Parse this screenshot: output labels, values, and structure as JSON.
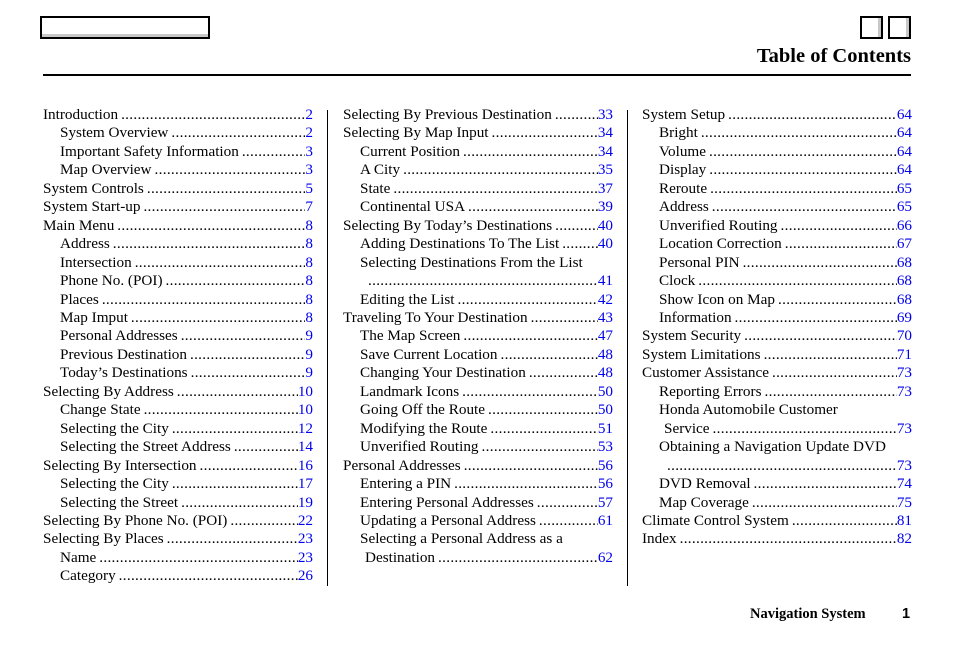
{
  "header": {
    "title": "Table of Contents"
  },
  "footer": {
    "section": "Navigation System",
    "page_number": "1"
  },
  "colors": {
    "link": "#0000ee",
    "text": "#000000"
  },
  "columns": [
    {
      "entries": [
        {
          "label": "Introduction",
          "page": "2",
          "level": 1
        },
        {
          "label": "System Overview",
          "page": "2",
          "level": 2
        },
        {
          "label": "Important Safety Information",
          "page": "3",
          "level": 2
        },
        {
          "label": "Map Overview",
          "page": "3",
          "level": 2
        },
        {
          "label": "System Controls",
          "page": "5",
          "level": 1
        },
        {
          "label": "System Start-up",
          "page": "7",
          "level": 1
        },
        {
          "label": "Main Menu",
          "page": "8",
          "level": 1
        },
        {
          "label": "Address",
          "page": "8",
          "level": 2
        },
        {
          "label": "Intersection",
          "page": "8",
          "level": 2
        },
        {
          "label": "Phone No. (POI)",
          "page": "8",
          "level": 2
        },
        {
          "label": "Places",
          "page": "8",
          "level": 2
        },
        {
          "label": "Map Imput",
          "page": "8",
          "level": 2
        },
        {
          "label": "Personal Addresses",
          "page": "9",
          "level": 2
        },
        {
          "label": "Previous Destination",
          "page": "9",
          "level": 2
        },
        {
          "label": "Today’s Destinations",
          "page": "9",
          "level": 2
        },
        {
          "label": "Selecting By Address",
          "page": "10",
          "level": 1
        },
        {
          "label": "Change State",
          "page": "10",
          "level": 2
        },
        {
          "label": "Selecting the City",
          "page": "12",
          "level": 2
        },
        {
          "label": "Selecting the Street Address",
          "page": "14",
          "level": 2
        },
        {
          "label": "Selecting By Intersection",
          "page": "16",
          "level": 1
        },
        {
          "label": "Selecting the City",
          "page": "17",
          "level": 2
        },
        {
          "label": "Selecting the Street",
          "page": "19",
          "level": 2
        },
        {
          "label": "Selecting By Phone No. (POI)",
          "page": "22",
          "level": 1
        },
        {
          "label": "Selecting By Places",
          "page": "23",
          "level": 1
        },
        {
          "label": "Name",
          "page": "23",
          "level": 2
        },
        {
          "label": "Category",
          "page": "26",
          "level": 2
        }
      ]
    },
    {
      "entries": [
        {
          "label": "Selecting By Previous Destination",
          "page": "33",
          "level": 1
        },
        {
          "label": "Selecting By Map Input",
          "page": "34",
          "level": 1
        },
        {
          "label": "Current Position",
          "page": "34",
          "level": 2
        },
        {
          "label": "A City",
          "page": "35",
          "level": 2
        },
        {
          "label": "State",
          "page": "37",
          "level": 2
        },
        {
          "label": "Continental USA",
          "page": "39",
          "level": 2
        },
        {
          "label": "Selecting By Today’s Destinations",
          "page": "40",
          "level": 1
        },
        {
          "label": "Adding Destinations To The List",
          "page": "40",
          "level": 2
        },
        {
          "label": "Selecting Destinations From the List",
          "page": "41",
          "level": 2,
          "wrap": true
        },
        {
          "label": "Editing the List",
          "page": "42",
          "level": 2
        },
        {
          "label": "Traveling To Your Destination",
          "page": "43",
          "level": 1
        },
        {
          "label": "The Map Screen",
          "page": "47",
          "level": 2
        },
        {
          "label": "Save Current Location",
          "page": "48",
          "level": 2
        },
        {
          "label": "Changing Your Destination",
          "page": "48",
          "level": 2
        },
        {
          "label": "Landmark Icons",
          "page": "50",
          "level": 2
        },
        {
          "label": "Going Off the Route",
          "page": "50",
          "level": 2
        },
        {
          "label": "Modifying the Route",
          "page": "51",
          "level": 2
        },
        {
          "label": "Unverified Routing",
          "page": "53",
          "level": 2
        },
        {
          "label": "Personal Addresses",
          "page": "56",
          "level": 1
        },
        {
          "label": "Entering a PIN",
          "page": "56",
          "level": 2
        },
        {
          "label": "Entering Personal Addresses",
          "page": "57",
          "level": 2
        },
        {
          "label": "Updating a Personal Address",
          "page": "61",
          "level": 2
        },
        {
          "label": "Selecting a Personal Address as a",
          "label2": "Destination",
          "page": "62",
          "level": 2,
          "split": true
        }
      ]
    },
    {
      "entries": [
        {
          "label": "System Setup",
          "page": "64",
          "level": 1
        },
        {
          "label": "Bright",
          "page": "64",
          "level": 2
        },
        {
          "label": "Volume",
          "page": "64",
          "level": 2
        },
        {
          "label": "Display",
          "page": "64",
          "level": 2
        },
        {
          "label": "Reroute",
          "page": "65",
          "level": 2
        },
        {
          "label": "Address",
          "page": "65",
          "level": 2
        },
        {
          "label": "Unverified Routing",
          "page": "66",
          "level": 2
        },
        {
          "label": "Location Correction",
          "page": "67",
          "level": 2
        },
        {
          "label": "Personal PIN",
          "page": "68",
          "level": 2
        },
        {
          "label": "Clock",
          "page": "68",
          "level": 2
        },
        {
          "label": "Show Icon on Map",
          "page": "68",
          "level": 2
        },
        {
          "label": "Information",
          "page": "69",
          "level": 2
        },
        {
          "label": "System Security",
          "page": "70",
          "level": 1
        },
        {
          "label": "System Limitations",
          "page": "71",
          "level": 1
        },
        {
          "label": "Customer Assistance",
          "page": "73",
          "level": 1
        },
        {
          "label": "Reporting Errors",
          "page": "73",
          "level": 2
        },
        {
          "label": "Honda Automobile Customer",
          "label2": "Service",
          "page": "73",
          "level": 2,
          "split": true
        },
        {
          "label": "Obtaining a Navigation Update DVD",
          "page": "73",
          "level": 2,
          "wrap": true
        },
        {
          "label": "DVD Removal",
          "page": "74",
          "level": 2
        },
        {
          "label": "Map Coverage",
          "page": "75",
          "level": 2
        },
        {
          "label": "Climate Control System",
          "page": "81",
          "level": 1
        },
        {
          "label": "Index",
          "page": "82",
          "level": 1
        }
      ]
    }
  ]
}
